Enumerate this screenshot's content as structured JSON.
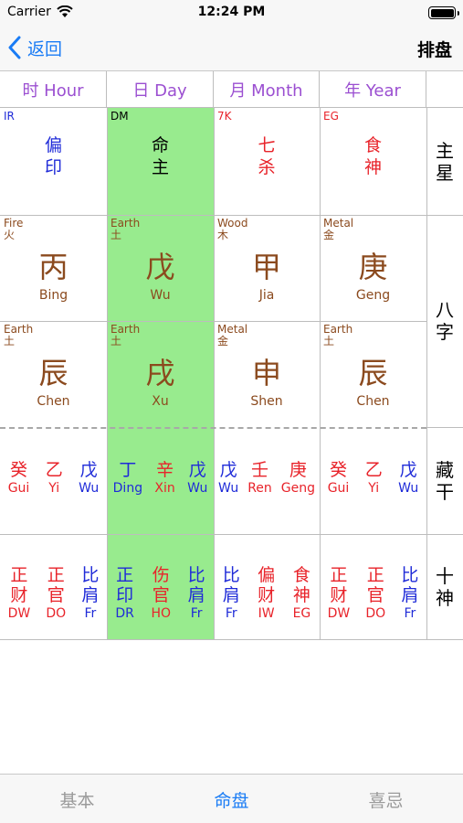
{
  "status": {
    "carrier": "Carrier",
    "time": "12:24 PM"
  },
  "nav": {
    "back_label": "返回",
    "title": "排盘"
  },
  "headers": [
    "时 Hour",
    "日 Day",
    "月 Month",
    "年 Year"
  ],
  "side_labels": {
    "main_star": "主星",
    "bazi": "八字",
    "hidden_stems": "藏干",
    "ten_gods": "十神"
  },
  "main_stars": [
    {
      "code": "IR",
      "l1": "偏",
      "l2": "印",
      "color": "#1f2bd8"
    },
    {
      "code": "DM",
      "l1": "命",
      "l2": "主",
      "color": "#000000"
    },
    {
      "code": "7K",
      "l1": "七",
      "l2": "杀",
      "color": "#e8232a"
    },
    {
      "code": "EG",
      "l1": "食",
      "l2": "神",
      "color": "#e8232a"
    }
  ],
  "stems": [
    {
      "el_en": "Fire",
      "el_zh": "火",
      "char": "丙",
      "py": "Bing"
    },
    {
      "el_en": "Earth",
      "el_zh": "土",
      "char": "戊",
      "py": "Wu"
    },
    {
      "el_en": "Wood",
      "el_zh": "木",
      "char": "甲",
      "py": "Jia"
    },
    {
      "el_en": "Metal",
      "el_zh": "金",
      "char": "庚",
      "py": "Geng"
    }
  ],
  "branches": [
    {
      "el_en": "Earth",
      "el_zh": "土",
      "char": "辰",
      "py": "Chen"
    },
    {
      "el_en": "Earth",
      "el_zh": "土",
      "char": "戌",
      "py": "Xu"
    },
    {
      "el_en": "Metal",
      "el_zh": "金",
      "char": "申",
      "py": "Shen"
    },
    {
      "el_en": "Earth",
      "el_zh": "土",
      "char": "辰",
      "py": "Chen"
    }
  ],
  "hidden": [
    [
      {
        "zh": "癸",
        "en": "Gui",
        "c": "red"
      },
      {
        "zh": "乙",
        "en": "Yi",
        "c": "red"
      },
      {
        "zh": "戊",
        "en": "Wu",
        "c": "blue"
      }
    ],
    [
      {
        "zh": "丁",
        "en": "Ding",
        "c": "blue"
      },
      {
        "zh": "辛",
        "en": "Xin",
        "c": "red"
      },
      {
        "zh": "戊",
        "en": "Wu",
        "c": "blue"
      }
    ],
    [
      {
        "zh": "戊",
        "en": "Wu",
        "c": "blue"
      },
      {
        "zh": "壬",
        "en": "Ren",
        "c": "red"
      },
      {
        "zh": "庚",
        "en": "Geng",
        "c": "red"
      }
    ],
    [
      {
        "zh": "癸",
        "en": "Gui",
        "c": "red"
      },
      {
        "zh": "乙",
        "en": "Yi",
        "c": "red"
      },
      {
        "zh": "戊",
        "en": "Wu",
        "c": "blue"
      }
    ]
  ],
  "ten_gods": [
    [
      {
        "a": "正",
        "b": "财",
        "en": "DW",
        "c": "red"
      },
      {
        "a": "正",
        "b": "官",
        "en": "DO",
        "c": "red"
      },
      {
        "a": "比",
        "b": "肩",
        "en": "Fr",
        "c": "blue"
      }
    ],
    [
      {
        "a": "正",
        "b": "印",
        "en": "DR",
        "c": "blue"
      },
      {
        "a": "伤",
        "b": "官",
        "en": "HO",
        "c": "red"
      },
      {
        "a": "比",
        "b": "肩",
        "en": "Fr",
        "c": "blue"
      }
    ],
    [
      {
        "a": "比",
        "b": "肩",
        "en": "Fr",
        "c": "blue"
      },
      {
        "a": "偏",
        "b": "财",
        "en": "IW",
        "c": "red"
      },
      {
        "a": "食",
        "b": "神",
        "en": "EG",
        "c": "red"
      }
    ],
    [
      {
        "a": "正",
        "b": "财",
        "en": "DW",
        "c": "red"
      },
      {
        "a": "正",
        "b": "官",
        "en": "DO",
        "c": "red"
      },
      {
        "a": "比",
        "b": "肩",
        "en": "Fr",
        "c": "blue"
      }
    ]
  ],
  "tabs": [
    {
      "label": "基本",
      "active": false
    },
    {
      "label": "命盘",
      "active": true
    },
    {
      "label": "喜忌",
      "active": false
    }
  ]
}
